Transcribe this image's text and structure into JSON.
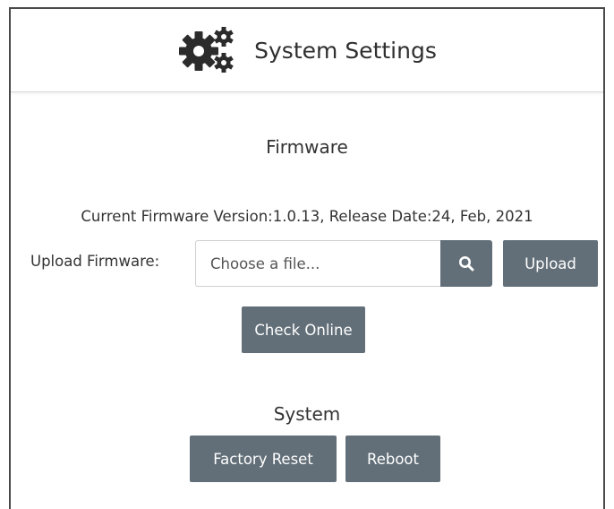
{
  "header": {
    "title": "System Settings",
    "icon": "gears-icon"
  },
  "firmware": {
    "section_title": "Firmware",
    "version_text": "Current Firmware Version:1.0.13, Release Date:24, Feb, 2021",
    "upload_label": "Upload Firmware:",
    "file_placeholder": "Choose a file...",
    "browse_icon": "search-icon",
    "upload_button": "Upload",
    "check_online_button": "Check Online"
  },
  "system": {
    "section_title": "System",
    "factory_reset_button": "Factory Reset",
    "reboot_button": "Reboot"
  },
  "colors": {
    "button_bg": "#626f78",
    "button_text": "#ffffff",
    "border": "#4a4a4a"
  }
}
